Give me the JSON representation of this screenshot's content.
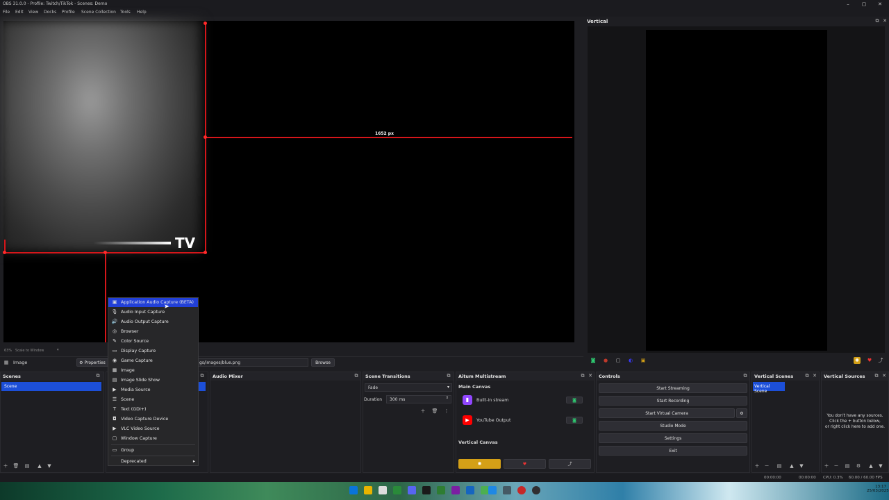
{
  "window": {
    "title": "OBS 31.0.0 - Profile: Twitch/TikTok - Scenes: Demo",
    "minimize": "–",
    "maximize": "▢",
    "close": "✕"
  },
  "menu": [
    "File",
    "Edit",
    "View",
    "Docks",
    "Profile",
    "Scene Collection",
    "Tools",
    "Help"
  ],
  "preview": {
    "measure_label": "1652 px",
    "logo_text": "TV"
  },
  "vertical": {
    "title": "Vertical"
  },
  "scale": {
    "zoom": "63%",
    "mode": "Scale to Window"
  },
  "source_bar": {
    "source_name": "Image",
    "properties_label": "Properties",
    "path": "gs/images/blue.png",
    "browse_label": "Browse"
  },
  "context_menu": {
    "items": [
      {
        "icon": "app-audio-icon",
        "glyph": "▣",
        "label": "Application Audio Capture (BETA)"
      },
      {
        "icon": "microphone-icon",
        "glyph": "🎙",
        "label": "Audio Input Capture"
      },
      {
        "icon": "speaker-icon",
        "glyph": "🔊",
        "label": "Audio Output Capture"
      },
      {
        "icon": "globe-icon",
        "glyph": "◎",
        "label": "Browser"
      },
      {
        "icon": "brush-icon",
        "glyph": "✎",
        "label": "Color Source"
      },
      {
        "icon": "monitor-icon",
        "glyph": "▭",
        "label": "Display Capture"
      },
      {
        "icon": "gamepad-icon",
        "glyph": "◉",
        "label": "Game Capture"
      },
      {
        "icon": "image-icon",
        "glyph": "▦",
        "label": "Image"
      },
      {
        "icon": "slideshow-icon",
        "glyph": "▤",
        "label": "Image Slide Show"
      },
      {
        "icon": "play-icon",
        "glyph": "▶",
        "label": "Media Source"
      },
      {
        "icon": "list-icon",
        "glyph": "☰",
        "label": "Scene"
      },
      {
        "icon": "text-icon",
        "glyph": "T",
        "label": "Text (GDI+)"
      },
      {
        "icon": "camera-icon",
        "glyph": "◘",
        "label": "Video Capture Device"
      },
      {
        "icon": "play-icon",
        "glyph": "▶",
        "label": "VLC Video Source"
      },
      {
        "icon": "window-icon",
        "glyph": "▢",
        "label": "Window Capture"
      }
    ],
    "group_label": "Group",
    "deprecated_label": "Deprecated"
  },
  "scenes": {
    "title": "Scenes",
    "items": [
      "Scene"
    ]
  },
  "audio_mixer": {
    "title": "Audio Mixer"
  },
  "transitions": {
    "title": "Scene Transitions",
    "selected": "Fade",
    "duration_label": "Duration",
    "duration_value": "300 ms"
  },
  "multistream": {
    "title": "Aitum Multistream",
    "main_canvas": "Main Canvas",
    "outputs": [
      {
        "name": "Built-in stream",
        "icon": "twitch-icon",
        "color": "#9146ff"
      },
      {
        "name": "YouTube Output",
        "icon": "youtube-icon",
        "color": "#ff0000"
      }
    ],
    "vertical_canvas": "Vertical Canvas"
  },
  "controls": {
    "title": "Controls",
    "buttons": [
      "Start Streaming",
      "Start Recording",
      "Start Virtual Camera",
      "Studio Mode",
      "Settings",
      "Exit"
    ]
  },
  "vertical_scenes": {
    "title": "Vertical Scenes",
    "items": [
      "Vertical Scene"
    ]
  },
  "vertical_sources": {
    "title": "Vertical Sources",
    "empty_line1": "You don't have any sources.",
    "empty_line2": "Click the + button below,",
    "empty_line3": "or right click here to add one."
  },
  "status": {
    "time1": "00:00:00",
    "time2": "00:00:00",
    "cpu": "CPU: 0.3%",
    "fps": "60.00 / 60.00 FPS",
    "clock": "13:17",
    "date": "25/03/2025"
  },
  "colors": {
    "accent_blue": "#1c4fd8",
    "selection_red": "#d6161a",
    "gold": "#d4a017"
  }
}
